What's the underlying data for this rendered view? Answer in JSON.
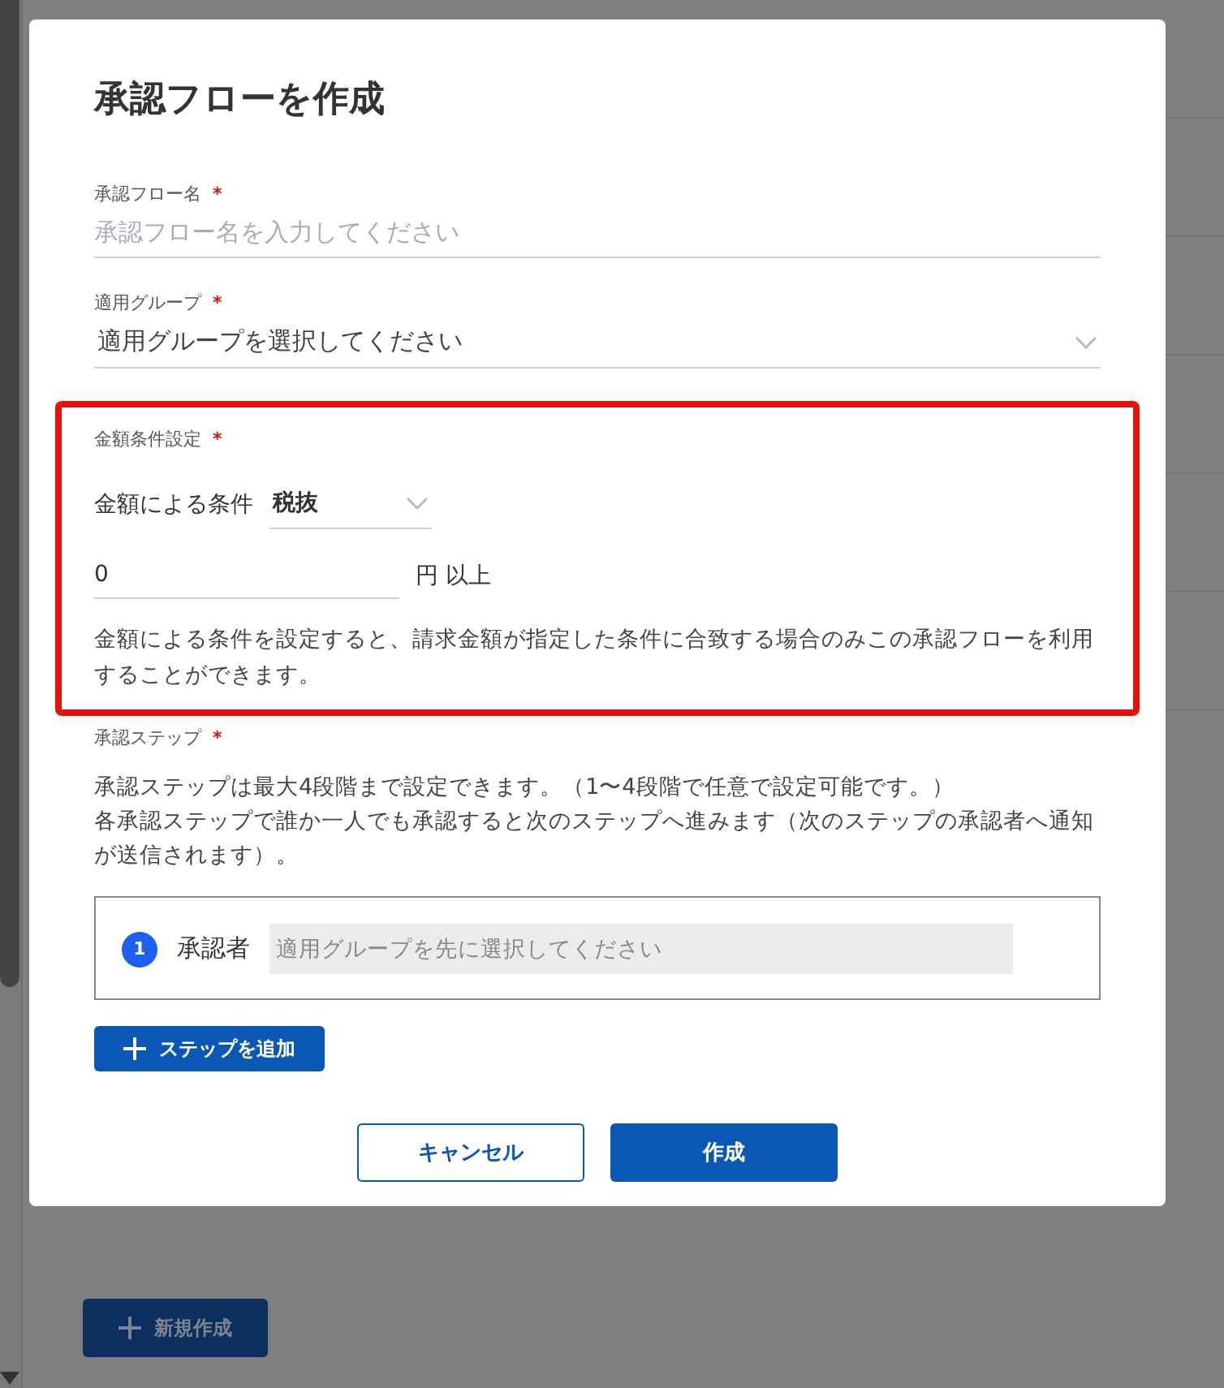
{
  "dialog": {
    "title": "承認フローを作成",
    "flow_name": {
      "label": "承認フロー名",
      "required_mark": "*",
      "placeholder": "承認フロー名を入力してください"
    },
    "group": {
      "label": "適用グループ",
      "required_mark": "*",
      "placeholder": "適用グループを選択してください"
    },
    "amount": {
      "label": "金額条件設定",
      "required_mark": "*",
      "highlighted": true,
      "condition_label": "金額による条件",
      "tax_select": {
        "value": "税抜"
      },
      "amount_input": {
        "value": "0"
      },
      "unit": "円 以上",
      "note": "金額による条件を設定すると、請求金額が指定した条件に合致する場合のみこの承認フローを利用することができます。"
    },
    "steps": {
      "label": "承認ステップ",
      "required_mark": "*",
      "description": [
        "承認ステップは最大4段階まで設定できます。（1〜4段階で任意で設定可能です。）",
        "各承認ステップで誰か一人でも承認すると次のステップへ進みます（次のステップの承認者へ通知が送信されます）。"
      ],
      "items": [
        {
          "number": "1",
          "label": "承認者",
          "placeholder": "適用グループを先に選択してください",
          "disabled": true
        }
      ],
      "add_button": "ステップを追加"
    },
    "buttons": [
      {
        "label": "キャンセル",
        "kind": "secondary"
      },
      {
        "label": "作成",
        "kind": "primary"
      }
    ]
  },
  "background": {
    "new_button": "新規作成"
  }
}
